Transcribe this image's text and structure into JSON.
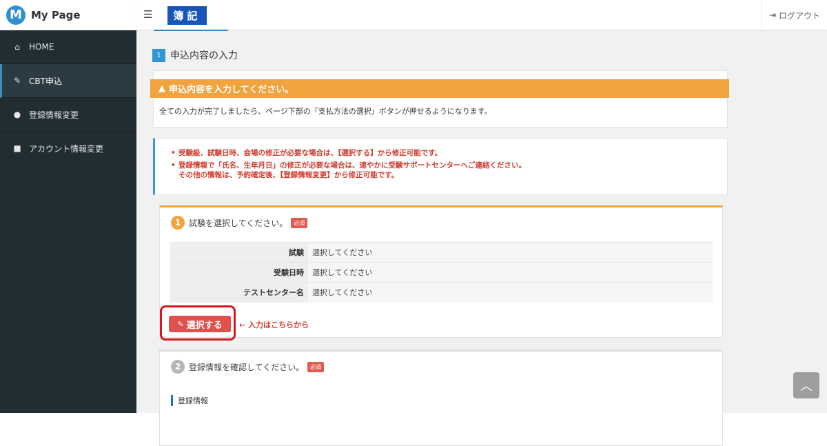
{
  "brand": {
    "logo_letter": "M",
    "name": "My Page"
  },
  "topbar": {
    "menu_icon": "hamburger-icon",
    "title": "簿記",
    "logout_label": "ログアウト",
    "logout_icon": "sign-out-icon"
  },
  "sidebar": {
    "items": [
      {
        "label": "HOME",
        "icon": "home-icon"
      },
      {
        "label": "CBT申込",
        "icon": "pencil-icon",
        "active": true
      },
      {
        "label": "登録情報変更",
        "icon": "user-icon"
      },
      {
        "label": "アカウント情報変更",
        "icon": "lock-icon"
      }
    ]
  },
  "main": {
    "step_number": "1",
    "step_title": "申込内容の入力",
    "notice": {
      "title": "申込内容を入力してください。",
      "text": "全ての入力が完了しましたら、ページ下部の「支払方法の選択」ボタンが押せるようになります。"
    },
    "info": [
      "受験級、試験日時、会場の修正が必要な場合は、【選択する】から修正可能です。",
      "登録情報で「氏名、生年月日」の修正が必要な場合は、速やかに受験サポートセンターへご連絡ください。",
      "その他の情報は、予約確定後、【登録情報変更】から修正可能です。"
    ],
    "section1": {
      "number": "1",
      "title": "試験を選択してください。",
      "required": "必須",
      "rows": [
        {
          "label": "試験",
          "value": "選択してください"
        },
        {
          "label": "受験日時",
          "value": "選択してください"
        },
        {
          "label": "テストセンター名",
          "value": "選択してください"
        }
      ],
      "select_button": "選択する",
      "hint": "入力はこちらから"
    },
    "section2": {
      "number": "2",
      "title": "登録情報を確認してください。",
      "required": "必須",
      "sub_heading": "登録情報"
    }
  },
  "colors": {
    "sidebar_bg": "#222d32",
    "accent_orange": "#f0a33f",
    "accent_blue": "#2e96d2",
    "danger": "#e0504c"
  }
}
